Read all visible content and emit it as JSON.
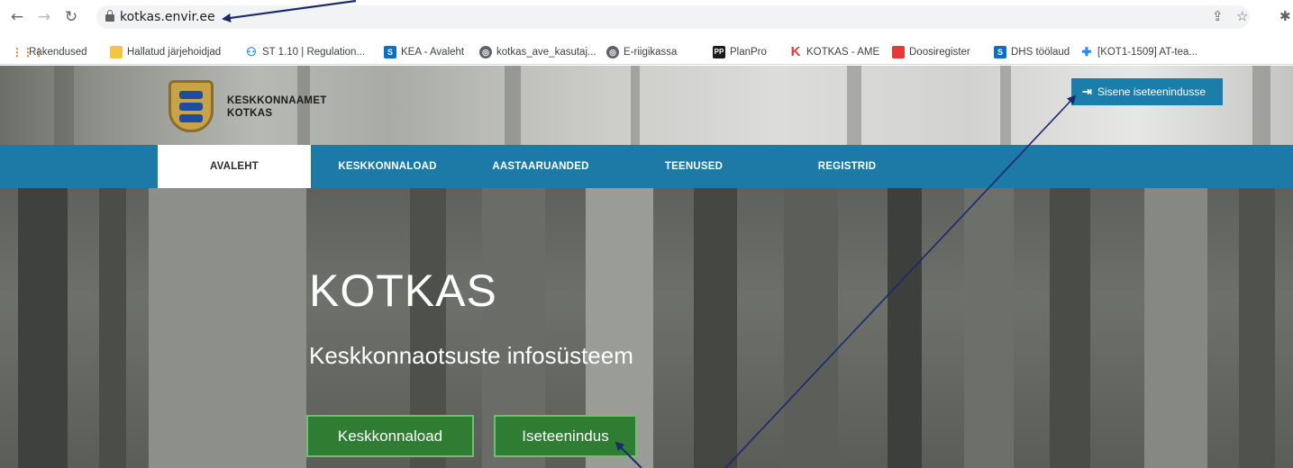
{
  "browser": {
    "url": "kotkas.envir.ee",
    "bookmarks": [
      {
        "label": "Rakendused",
        "icon": "apps-grid-icon"
      },
      {
        "label": "Hallatud järjehoidjad",
        "icon": "folder-icon"
      },
      {
        "label": "ST 1.10 | Regulation...",
        "icon": "confluence-icon"
      },
      {
        "label": "KEA - Avaleht",
        "icon": "sharepoint-icon"
      },
      {
        "label": "kotkas_ave_kasutaj...",
        "icon": "globe-icon"
      },
      {
        "label": "E-riigikassa",
        "icon": "globe-icon"
      },
      {
        "label": "PlanPro",
        "icon": "planpro-icon"
      },
      {
        "label": "KOTKAS - AME",
        "icon": "kotkas-k-icon"
      },
      {
        "label": "Doosiregister",
        "icon": "doosi-icon"
      },
      {
        "label": "DHS töölaud",
        "icon": "sharepoint-icon"
      },
      {
        "label": "[KOT1-1509] AT-tea...",
        "icon": "jira-icon"
      }
    ]
  },
  "header": {
    "logo_line1": "KESKKONNAAMET",
    "logo_line2": "KOTKAS",
    "login_label": "Sisene iseteenindusse"
  },
  "nav": {
    "items": [
      "AVALEHT",
      "KESKKONNALOAD",
      "AASTAARUANDED",
      "TEENUSED",
      "REGISTRID"
    ],
    "active": "AVALEHT"
  },
  "hero": {
    "title": "KOTKAS",
    "subtitle": "Keskkonnaotsuste infosüsteem",
    "button_primary": "Keskkonnaload",
    "button_secondary": "Iseteenindus"
  },
  "colors": {
    "nav_blue": "#1d7aa6",
    "login_blue": "#1b7eaa",
    "hero_button_green": "#2e7d32",
    "annotation_arrow": "#1a2a6c"
  }
}
